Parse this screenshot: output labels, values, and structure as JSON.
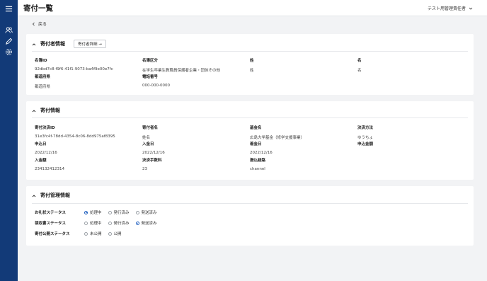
{
  "header": {
    "title": "寄付一覧",
    "user_name": "テスト用管理責任者"
  },
  "nav": {
    "back_label": "戻る"
  },
  "donor": {
    "section_title": "寄付者情報",
    "detail_button": "寄付者詳細 →",
    "fields": [
      {
        "label": "名簿ID",
        "value": "92dbd7c8-f9f6-41f1-9073-ba4f9e00e7fc"
      },
      {
        "label": "名簿区分",
        "value": "在学生卒業生教職員保護者企業・団体その他"
      },
      {
        "label": "姓",
        "value": "姓"
      },
      {
        "label": "名",
        "value": "名"
      },
      {
        "label": "都道府県",
        "value": "都道府県"
      },
      {
        "label": "電話番号",
        "value": "000-000-0000"
      }
    ]
  },
  "donation": {
    "section_title": "寄付情報",
    "fields": [
      {
        "label": "寄付決済ID",
        "value": "31e3fc4f-78dd-4354-8c06-8dd975af8395"
      },
      {
        "label": "寄付者名",
        "value": "姓名"
      },
      {
        "label": "基金名",
        "value": "広島大学基金（修学支援事業）"
      },
      {
        "label": "決済方法",
        "value": "ゆうちょ"
      },
      {
        "label": "申込日",
        "value": "2022/12/16"
      },
      {
        "label": "入金日",
        "value": "2022/12/16"
      },
      {
        "label": "着金日",
        "value": "2022/12/16"
      },
      {
        "label": "申込金額",
        "value": ""
      },
      {
        "label": "入金額",
        "value": "234132412314"
      },
      {
        "label": "決済手数料",
        "value": "23"
      },
      {
        "label": "振込経路",
        "value": "channel"
      }
    ]
  },
  "management": {
    "section_title": "寄付管理情報",
    "rows": [
      {
        "label": "お礼状ステータス",
        "options": [
          "処理中",
          "発行済み",
          "発送済み"
        ],
        "selected": "処理中"
      },
      {
        "label": "領収書ステータス",
        "options": [
          "処理中",
          "発行済み",
          "発送済み"
        ],
        "selected": "発送済み"
      },
      {
        "label": "寄付公開ステータス",
        "options": [
          "未公開",
          "公開"
        ],
        "selected": ""
      }
    ]
  }
}
